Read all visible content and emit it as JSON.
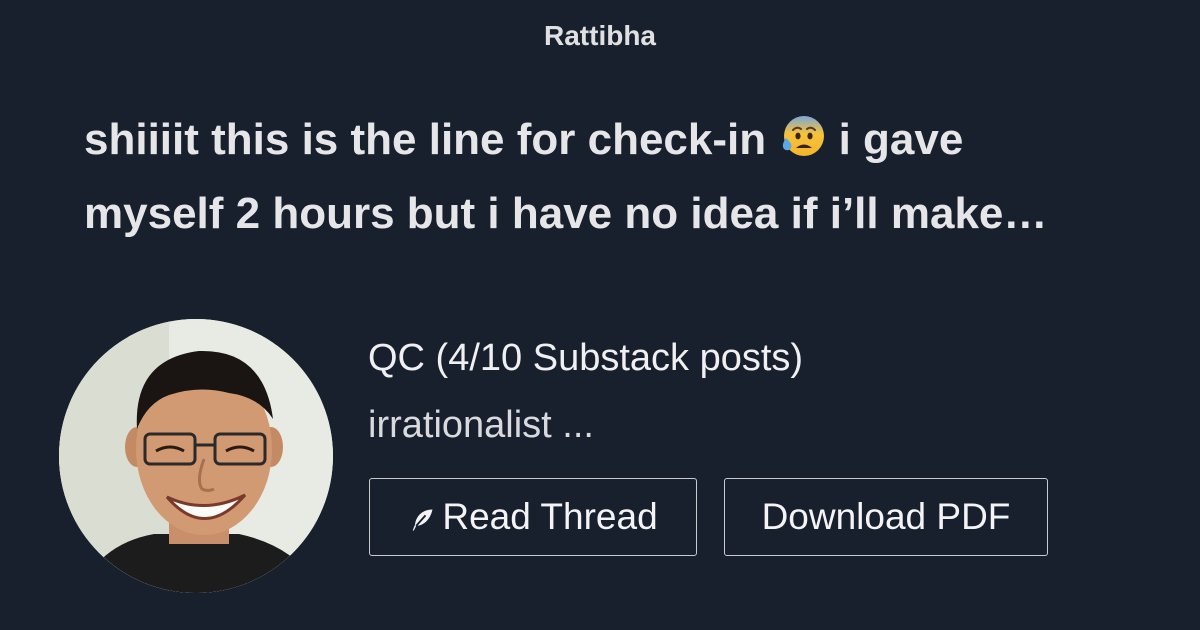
{
  "site": {
    "name": "Rattibha"
  },
  "thread": {
    "title_line1_before_emoji": "shiiiit this is the line for check-in",
    "emoji_icon": "anxious-face-with-sweat-icon",
    "title_line1_after_emoji": "i gave",
    "title_line2": "myself 2 hours but i have no idea if i’ll make…"
  },
  "author": {
    "name": "QC (4/10 Substack posts)",
    "bio": "irrationalist ..."
  },
  "actions": {
    "read_label": "Read Thread",
    "read_icon": "feather-icon",
    "pdf_label": "Download PDF"
  },
  "colors": {
    "background": "#18202d",
    "text": "#e6e6e9",
    "button_border": "#c9cbd1"
  }
}
